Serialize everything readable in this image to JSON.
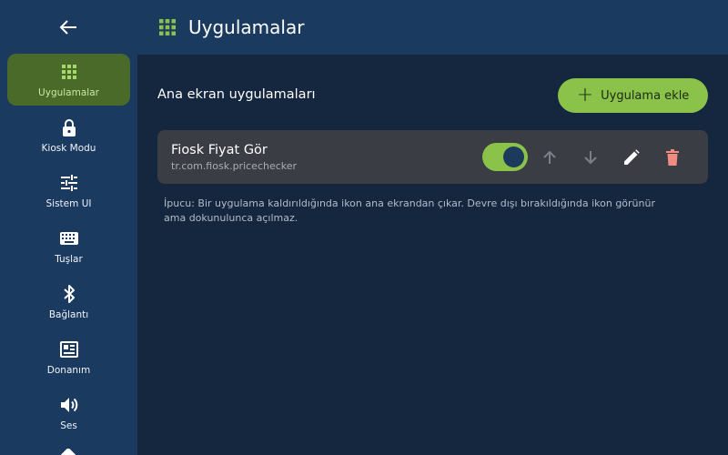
{
  "header": {
    "title": "Uygulamalar",
    "icon": "apps-grid-icon"
  },
  "sidebar": {
    "items": [
      {
        "label": "Uygulamalar",
        "icon": "apps-grid-icon",
        "active": true
      },
      {
        "label": "Kiosk Modu",
        "icon": "lock-icon"
      },
      {
        "label": "Sistem UI",
        "icon": "tune-icon"
      },
      {
        "label": "Tuşlar",
        "icon": "keyboard-icon"
      },
      {
        "label": "Bağlantı",
        "icon": "bluetooth-icon"
      },
      {
        "label": "Donanım",
        "icon": "hardware-icon"
      },
      {
        "label": "Ses",
        "icon": "volume-icon"
      }
    ]
  },
  "main": {
    "section_title": "Ana ekran uygulamaları",
    "add_button_label": "Uygulama ekle",
    "apps": [
      {
        "name": "Fiosk Fiyat Gör",
        "package": "tr.com.fiosk.pricechecker",
        "enabled": true
      }
    ],
    "hint": "İpucu: Bir uygulama kaldırıldığında ikon ana ekrandan çıkar. Devre dışı bırakıldığında ikon görünür ama dokunulunca açılmaz."
  },
  "colors": {
    "accent": "#8bc34a",
    "sidebar_bg": "#1b3a60",
    "content_bg": "#14273f",
    "card_bg": "#3a3d44",
    "delete": "#f28b82"
  }
}
